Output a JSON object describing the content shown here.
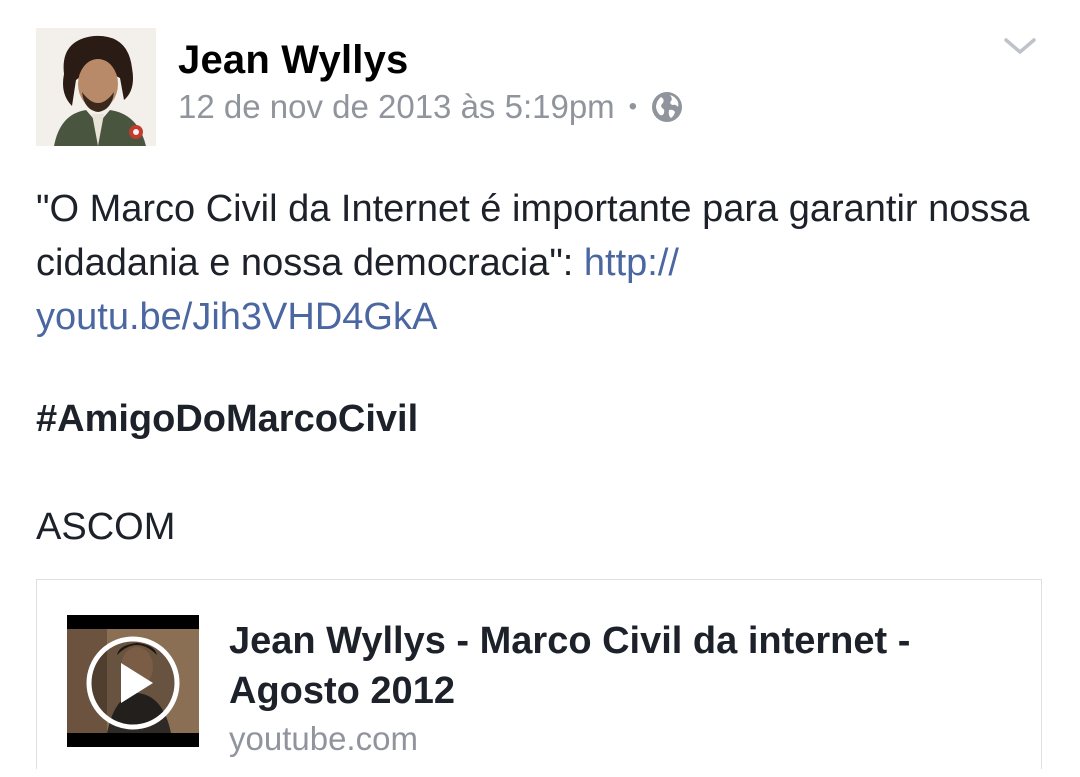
{
  "post": {
    "author": "Jean Wyllys",
    "timestamp": "12 de nov de 2013 às 5:19pm",
    "separator": "•",
    "privacy_icon": "globe-icon",
    "menu_icon": "chevron-down-icon",
    "text_before_link": "\"O Marco Civil da Internet é importante para garantir nossa cidadania e nossa democracia\": ",
    "link_text": "http:// youtu.be/Jih3VHD4GkA",
    "hashtag": "#AmigoDoMarcoCivil",
    "signoff": "ASCOM"
  },
  "link_card": {
    "title": "Jean Wyllys - Marco Civil da internet - Agosto 2012",
    "domain": "youtube.com",
    "thumbnail_icon": "play-icon"
  },
  "colors": {
    "link": "#4b67a1",
    "meta": "#90949c",
    "text": "#1d2129"
  }
}
